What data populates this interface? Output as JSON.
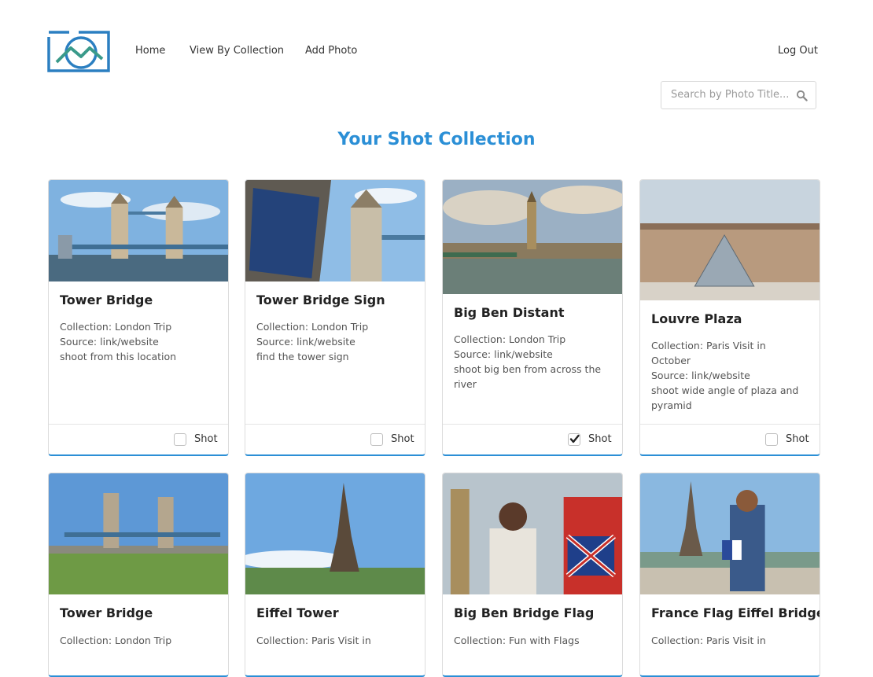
{
  "nav": {
    "home": "Home",
    "collections": "View By Collection",
    "add_photo": "Add Photo",
    "logout": "Log Out"
  },
  "search": {
    "placeholder": "Search by Photo Title..."
  },
  "page_title": "Your Shot Collection",
  "colors": {
    "accent": "#2b8fd6",
    "logo_blue": "#2b7fc1",
    "logo_teal": "#3a9a8a"
  },
  "icons": {
    "search": "search-icon",
    "check": "check-icon",
    "logo": "camera-mountain-logo-icon"
  },
  "cards": [
    {
      "title": "Tower Bridge",
      "lines": [
        "Collection: London Trip",
        "Source: link/website",
        "shoot from this location"
      ],
      "shot_label": "Shot",
      "checked": false
    },
    {
      "title": "Tower Bridge Sign",
      "lines": [
        "Collection: London Trip",
        "Source: link/website",
        "find the tower sign"
      ],
      "shot_label": "Shot",
      "checked": false
    },
    {
      "title": "Big Ben Distant",
      "lines": [
        "Collection: London Trip",
        "Source: link/website",
        "shoot big ben from across the",
        "river"
      ],
      "shot_label": "Shot",
      "checked": true
    },
    {
      "title": "Louvre Plaza",
      "lines": [
        "Collection: Paris Visit in",
        "October",
        "Source: link/website",
        "shoot wide angle of plaza and",
        "pyramid"
      ],
      "shot_label": "Shot",
      "checked": false
    },
    {
      "title": "Tower Bridge",
      "lines": [
        "Collection: London Trip"
      ]
    },
    {
      "title": "Eiffel Tower",
      "lines": [
        "Collection: Paris Visit in"
      ]
    },
    {
      "title": "Big Ben Bridge Flag",
      "lines": [
        "Collection: Fun with Flags"
      ]
    },
    {
      "title": "France Flag Eiffel Bridge",
      "lines": [
        "Collection: Paris Visit in"
      ]
    }
  ]
}
